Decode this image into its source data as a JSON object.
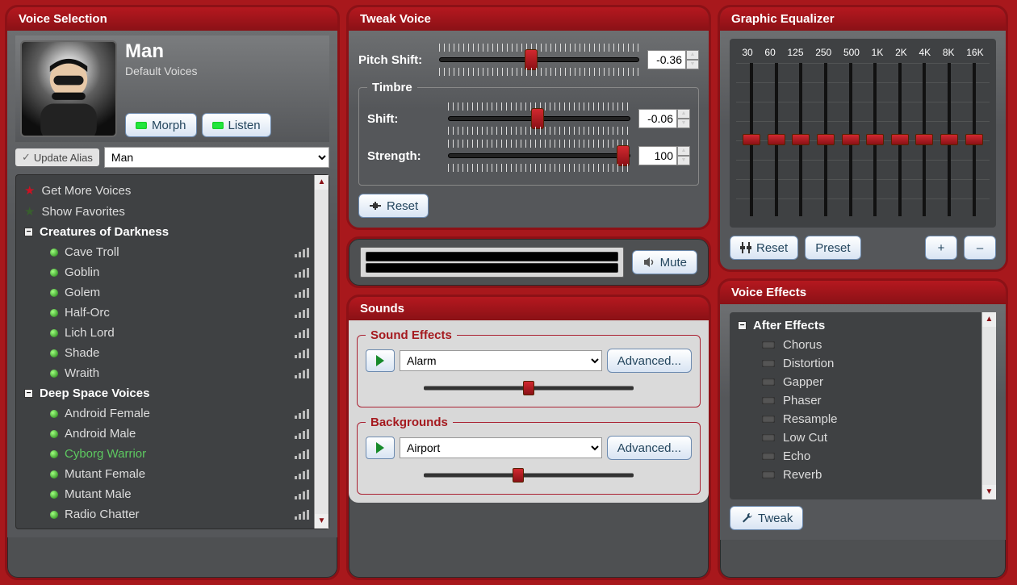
{
  "voiceSelection": {
    "title": "Voice Selection",
    "currentName": "Man",
    "currentSub": "Default Voices",
    "morphLabel": "Morph",
    "listenLabel": "Listen",
    "updateAliasLabel": "Update Alias",
    "comboValue": "Man",
    "getMore": "Get More Voices",
    "showFav": "Show Favorites",
    "groups": [
      {
        "name": "Creatures of Darkness",
        "voices": [
          "Cave Troll",
          "Goblin",
          "Golem",
          "Half-Orc",
          "Lich Lord",
          "Shade",
          "Wraith"
        ]
      },
      {
        "name": "Deep Space Voices",
        "voices": [
          "Android Female",
          "Android Male",
          "Cyborg Warrior",
          "Mutant Female",
          "Mutant Male",
          "Radio Chatter"
        ]
      }
    ],
    "highlight": "Cyborg Warrior"
  },
  "tweak": {
    "title": "Tweak Voice",
    "pitchLabel": "Pitch Shift:",
    "pitchValue": "-0.36",
    "pitchPos": 46,
    "timbreLegend": "Timbre",
    "shiftLabel": "Shift:",
    "shiftValue": "-0.06",
    "shiftPos": 49,
    "strengthLabel": "Strength:",
    "strengthValue": "100",
    "strengthPos": 96,
    "resetLabel": "Reset"
  },
  "vu": {
    "muteLabel": "Mute"
  },
  "sounds": {
    "title": "Sounds",
    "sfxLegend": "Sound Effects",
    "sfxValue": "Alarm",
    "sfxAdvanced": "Advanced...",
    "sfxPos": 50,
    "bgLegend": "Backgrounds",
    "bgValue": "Airport",
    "bgAdvanced": "Advanced...",
    "bgPos": 45
  },
  "eq": {
    "title": "Graphic Equalizer",
    "bands": [
      "30",
      "60",
      "125",
      "250",
      "500",
      "1K",
      "2K",
      "4K",
      "8K",
      "16K"
    ],
    "positions": [
      50,
      50,
      50,
      50,
      50,
      50,
      50,
      50,
      50,
      50
    ],
    "resetLabel": "Reset",
    "presetLabel": "Preset",
    "plusLabel": "+",
    "minusLabel": "–"
  },
  "effects": {
    "title": "Voice Effects",
    "group": "After Effects",
    "items": [
      "Chorus",
      "Distortion",
      "Gapper",
      "Phaser",
      "Resample",
      "Low Cut",
      "Echo",
      "Reverb"
    ],
    "tweakLabel": "Tweak"
  }
}
